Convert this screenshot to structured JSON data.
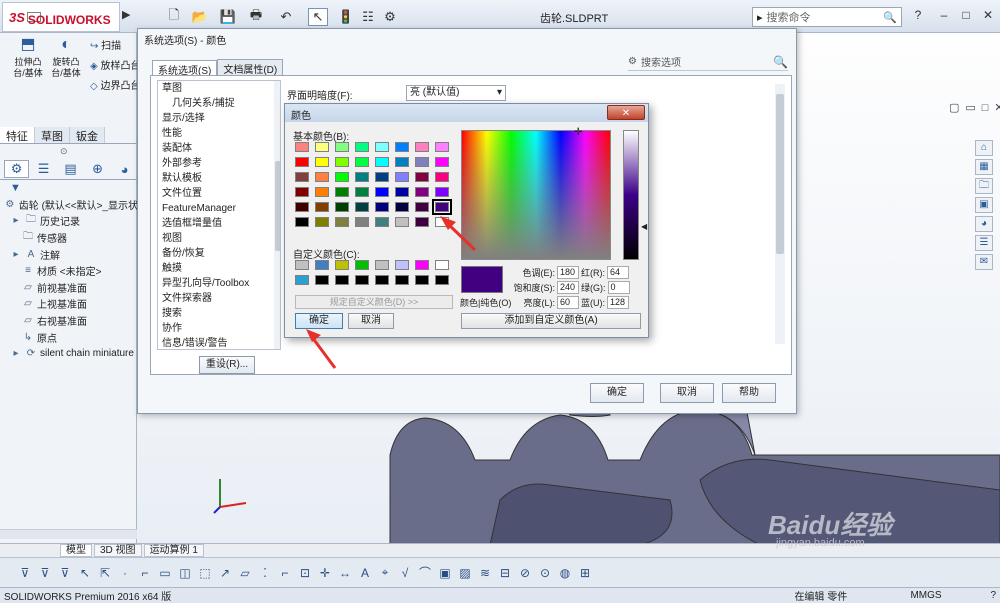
{
  "app": {
    "brand": "SOLIDWORKS",
    "brand_prefix": "3S",
    "doc_title": "齿轮.SLDPRT"
  },
  "command_search": {
    "placeholder": "搜索命令",
    "help": "?",
    "min": "–",
    "max": "□",
    "close": "✕"
  },
  "ribbon": {
    "buttons": [
      {
        "label": "拉伸凸\n台/基体"
      },
      {
        "label": "旋转凸\n台/基体"
      }
    ],
    "small_buttons": [
      {
        "label": "扫描"
      },
      {
        "label": "放样凸台"
      },
      {
        "label": "边界凸台"
      }
    ]
  },
  "cm_tabs": [
    "特征",
    "草图",
    "钣金"
  ],
  "tree": {
    "root": "齿轮 (默认<<默认>_显示状",
    "items": [
      "历史记录",
      "传感器",
      "注解",
      "材质 <未指定>",
      "前视基准面",
      "上视基准面",
      "右视基准面",
      "原点",
      "silent chain miniature"
    ]
  },
  "bottom_tabs": [
    "模型",
    "3D 视图",
    "运动算例 1"
  ],
  "status": {
    "left": "SOLIDWORKS Premium 2016 x64 版",
    "mode": "在编辑 零件",
    "units": "MMGS"
  },
  "sys_dialog": {
    "title": "系统选项(S) - 颜色",
    "tabs": [
      "系统选项(S)",
      "文档属性(D)"
    ],
    "search_placeholder": "搜索选项",
    "options": [
      "草图",
      "几何关系/捕捉",
      "显示/选择",
      "性能",
      "装配体",
      "外部参考",
      "默认模板",
      "文件位置",
      "FeatureManager",
      "选值框增量值",
      "视图",
      "备份/恢复",
      "触摸",
      "异型孔向导/Toolbox",
      "文件探索器",
      "搜索",
      "协作",
      "信息/错误/警告"
    ],
    "reset": "重设(R)...",
    "brightness_label": "界面明暗度(F):",
    "brightness_value": "亮 (默认值)",
    "ok": "确定",
    "cancel": "取消",
    "help": "帮助"
  },
  "color_dialog": {
    "title": "颜色",
    "close": "✕",
    "basic_label": "基本颜色(B):",
    "custom_label": "自定义颜色(C):",
    "basic_colors": [
      "#ff8080",
      "#ffff80",
      "#80ff80",
      "#00ff80",
      "#80ffff",
      "#0080ff",
      "#ff80c0",
      "#ff80ff",
      "#ff0000",
      "#ffff00",
      "#80ff00",
      "#00ff40",
      "#00ffff",
      "#0080c0",
      "#8080c0",
      "#ff00ff",
      "#804040",
      "#ff8040",
      "#00ff00",
      "#008080",
      "#004080",
      "#8080ff",
      "#800040",
      "#ff0080",
      "#800000",
      "#ff8000",
      "#008000",
      "#008040",
      "#0000ff",
      "#0000a0",
      "#800080",
      "#8000ff",
      "#400000",
      "#804000",
      "#004000",
      "#004040",
      "#000080",
      "#000040",
      "#400040",
      "#400080",
      "#000000",
      "#808000",
      "#808040",
      "#808080",
      "#408080",
      "#c0c0c0",
      "#400040",
      "#ffffff"
    ],
    "selected_index": 39,
    "custom_colors": [
      "#c0c0c0",
      "#4080c0",
      "#c0c000",
      "#00c000",
      "#c0c0c0",
      "#c0c0ff",
      "#ff00ff",
      "#ffffff",
      "#2a9fd0",
      "#000000",
      "#000000",
      "#000000",
      "#000000",
      "#000000",
      "#000000",
      "#000000"
    ],
    "define_custom": "规定自定义颜色(D) >>",
    "ok": "确定",
    "cancel": "取消",
    "current_color": "#400080",
    "preview_label": "颜色|纯色(O)",
    "hue_label": "色调(E):",
    "hue": "180",
    "sat_label": "饱和度(S):",
    "sat": "240",
    "lum_label": "亮度(L):",
    "lum": "60",
    "red_label": "红(R):",
    "red": "64",
    "green_label": "绿(G):",
    "green": "0",
    "blue_label": "蓝(U):",
    "blue": "128",
    "add_custom": "添加到自定义颜色(A)"
  },
  "watermark": {
    "brand": "Baidu经验",
    "url": "jingyan.baidu.com"
  }
}
